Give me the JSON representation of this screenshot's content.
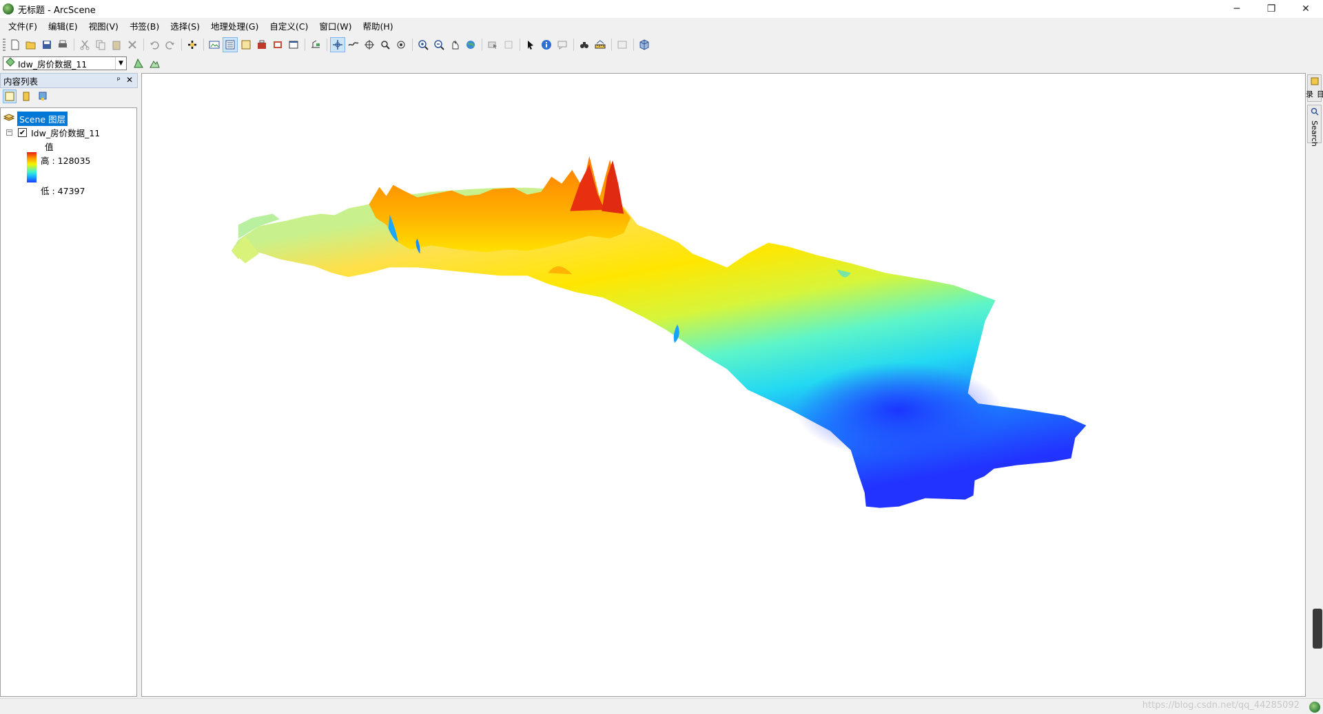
{
  "window": {
    "title": "无标题 - ArcScene",
    "controls": {
      "minimize": "─",
      "restore": "❐",
      "close": "✕"
    }
  },
  "menu": [
    "文件(F)",
    "编辑(E)",
    "视图(V)",
    "书签(B)",
    "选择(S)",
    "地理处理(G)",
    "自定义(C)",
    "窗口(W)",
    "帮助(H)"
  ],
  "toolbar": {
    "icons": [
      "new-document-icon",
      "open-folder-icon",
      "save-icon",
      "print-icon",
      "cut-icon",
      "copy-icon",
      "paste-icon",
      "delete-icon",
      "undo-icon",
      "redo-icon",
      "add-data-icon",
      "window-icon",
      "catalog-icon",
      "toc-icon",
      "arctoolbox-icon",
      "python-icon",
      "model-icon",
      "navigate-icon",
      "fly-icon",
      "center-target-icon",
      "zoom-to-target-icon",
      "set-observer-icon",
      "zoom-in-icon",
      "zoom-out-icon",
      "pan-icon",
      "full-extent-icon",
      "select-features-icon",
      "clear-selection-icon",
      "select-elements-icon",
      "identify-icon",
      "html-popup-icon",
      "find-icon",
      "measure-icon",
      "animation-icon",
      "3d-effects-icon"
    ],
    "layer_dropdown": {
      "value": "Idw_房价数据_11"
    }
  },
  "toc": {
    "title": "内容列表",
    "pin": "ᵖ",
    "close": "✕",
    "scene_layer": "Scene 图层",
    "layer_name": "Idw_房价数据_11",
    "checked": "✔",
    "expander": "−",
    "legend": {
      "field": "值",
      "high": "高 : 128035",
      "low": "低 : 47397",
      "colors": [
        "#e52012",
        "#ff9800",
        "#f5f500",
        "#41f3c9",
        "#19b6ff",
        "#1a3cff"
      ]
    }
  },
  "right_dock": {
    "tab1": "目录",
    "tab2": "Search"
  },
  "status": {
    "watermark": "https://blog.csdn.net/qq_44285092"
  }
}
